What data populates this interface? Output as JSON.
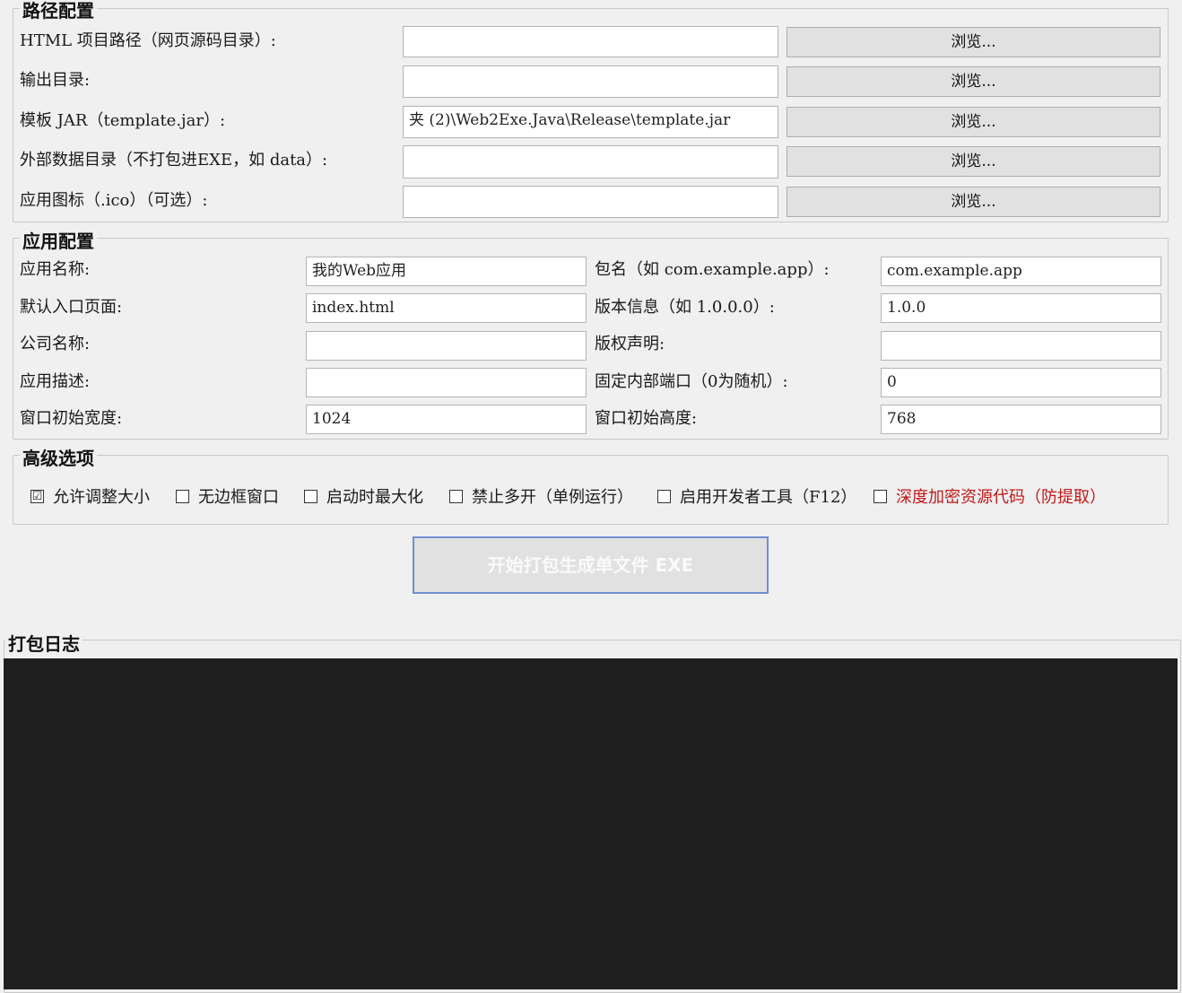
{
  "paths": {
    "title": "路径配置",
    "rows": [
      {
        "label": "HTML 项目路径（网页源码目录）:",
        "value": "",
        "browse": "浏览..."
      },
      {
        "label": "输出目录:",
        "value": "",
        "browse": "浏览..."
      },
      {
        "label": "模板 JAR（template.jar）:",
        "value": "夹 (2)\\Web2Exe.Java\\Release\\template.jar",
        "browse": "浏览..."
      },
      {
        "label": "外部数据目录（不打包进EXE，如 data）:",
        "value": "",
        "browse": "浏览..."
      },
      {
        "label": "应用图标（.ico）（可选）:",
        "value": "",
        "browse": "浏览..."
      }
    ]
  },
  "app": {
    "title": "应用配置",
    "left": [
      {
        "label": "应用名称:",
        "value": "我的Web应用"
      },
      {
        "label": "默认入口页面:",
        "value": "index.html"
      },
      {
        "label": "公司名称:",
        "value": ""
      },
      {
        "label": "应用描述:",
        "value": ""
      },
      {
        "label": "窗口初始宽度:",
        "value": "1024"
      }
    ],
    "right": [
      {
        "label": "包名（如 com.example.app）:",
        "value": "com.example.app"
      },
      {
        "label": "版本信息（如 1.0.0.0）:",
        "value": "1.0.0"
      },
      {
        "label": "版权声明:",
        "value": ""
      },
      {
        "label": "固定内部端口（0为随机）:",
        "value": "0"
      },
      {
        "label": "窗口初始高度:",
        "value": "768"
      }
    ]
  },
  "advanced": {
    "title": "高级选项",
    "options": [
      {
        "label": "允许调整大小",
        "checked": true,
        "mark": "☑"
      },
      {
        "label": "无边框窗口",
        "checked": false,
        "mark": ""
      },
      {
        "label": "启动时最大化",
        "checked": false,
        "mark": ""
      },
      {
        "label": "禁止多开（单例运行）",
        "checked": false,
        "mark": ""
      },
      {
        "label": "启用开发者工具（F12）",
        "checked": false,
        "mark": ""
      },
      {
        "label": "深度加密资源代码（防提取）",
        "checked": false,
        "mark": "",
        "color": "#c21818"
      }
    ]
  },
  "build": {
    "label": "开始打包生成单文件 EXE"
  },
  "log": {
    "title": "打包日志",
    "content": ""
  },
  "colors": {
    "window_bg": "#f0f0f0",
    "log_bg": "#1e1e1e",
    "danger": "#c21818",
    "focus_border": "#6f8fd0"
  }
}
